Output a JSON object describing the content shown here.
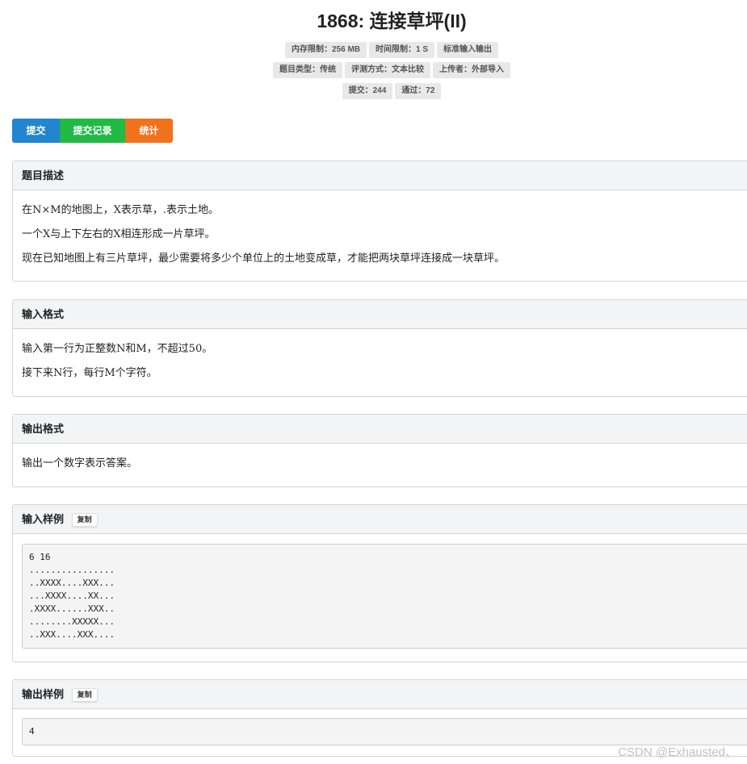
{
  "problem": {
    "title": "1868: 连接草坪(II)",
    "badges_row1": [
      "内存限制：256 MB",
      "时间限制：1 S",
      "标准输入输出"
    ],
    "badges_row2": [
      "题目类型：传统",
      "评测方式：文本比较",
      "上传者：外部导入"
    ],
    "badges_row3": [
      "提交：244",
      "通过：72"
    ]
  },
  "actions": {
    "submit": "提交",
    "records": "提交记录",
    "stats": "统计"
  },
  "description": {
    "heading": "题目描述",
    "lines": [
      "在N×M的地图上，X表示草，.表示土地。",
      "一个X与上下左右的X相连形成一片草坪。",
      "现在已知地图上有三片草坪，最少需要将多少个单位上的土地变成草，才能把两块草坪连接成一块草坪。"
    ]
  },
  "input_format": {
    "heading": "输入格式",
    "lines": [
      "输入第一行为正整数N和M，不超过50。",
      "接下来N行，每行M个字符。"
    ]
  },
  "output_format": {
    "heading": "输出格式",
    "lines": [
      "输出一个数字表示答案。"
    ]
  },
  "sample_input": {
    "heading": "输入样例",
    "copy_label": "复制",
    "code": "6 16\n................\n..XXXX....XXX...\n...XXXX....XX...\n.XXXX......XXX..\n........XXXXX...\n..XXX....XXX...."
  },
  "sample_output": {
    "heading": "输出样例",
    "copy_label": "复制",
    "code": "4"
  },
  "watermark": "CSDN @Exhausted、"
}
